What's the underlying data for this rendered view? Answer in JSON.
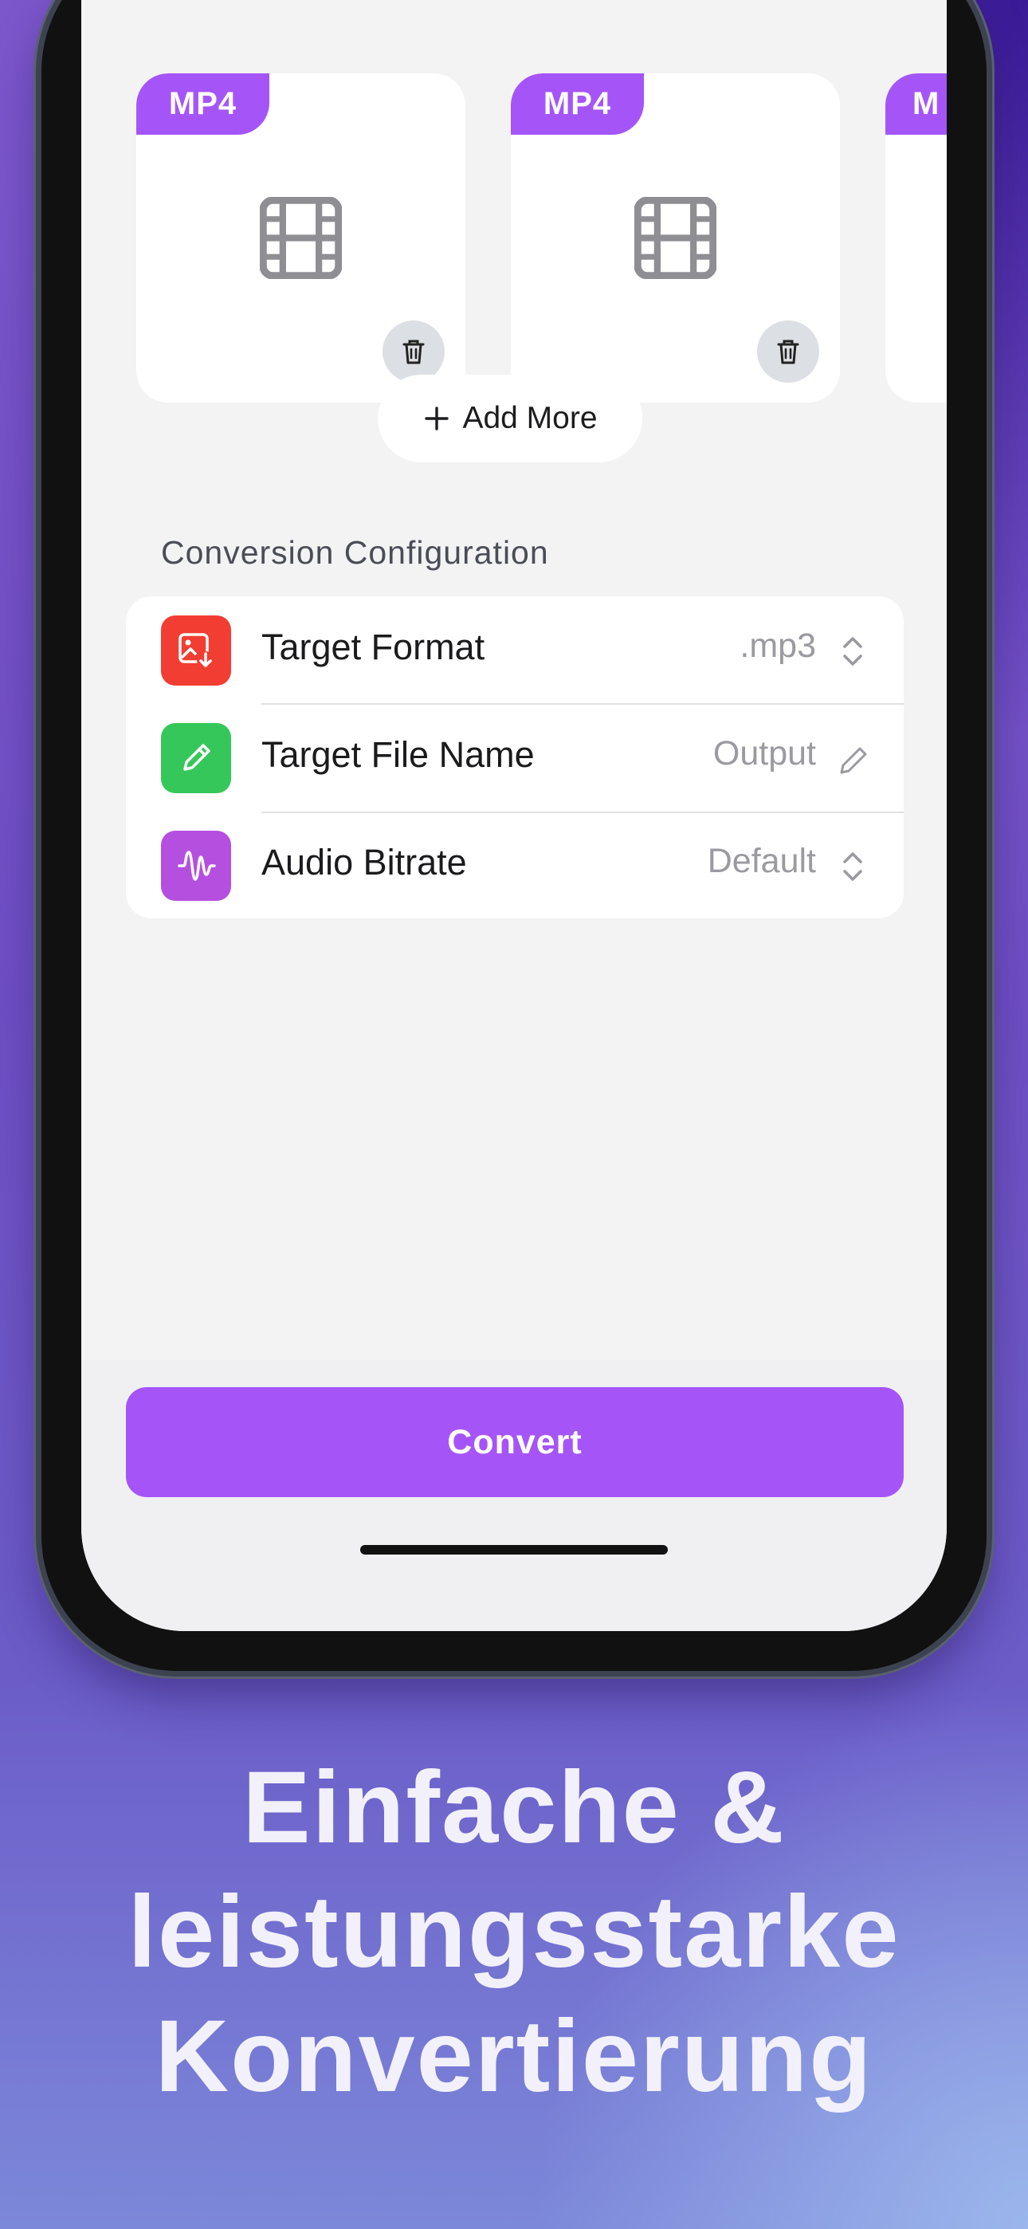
{
  "files": [
    {
      "badge": "MP4"
    },
    {
      "badge": "MP4"
    },
    {
      "badge": "M"
    }
  ],
  "add_more_label": "Add More",
  "config": {
    "section_title": "Conversion Configuration",
    "rows": [
      {
        "label": "Target Format",
        "value": ".mp3",
        "icon": "image-download-icon",
        "icon_color": "#f23d33",
        "accessory": "chevron-up-down-icon"
      },
      {
        "label": "Target File Name",
        "value": "Output",
        "icon": "pencil-icon",
        "icon_color": "#35c75a",
        "accessory": "pencil-icon"
      },
      {
        "label": "Audio Bitrate",
        "value": "Default",
        "icon": "waveform-icon",
        "icon_color": "#b54fe0",
        "accessory": "chevron-up-down-icon"
      }
    ]
  },
  "convert_label": "Convert",
  "headline": {
    "line1": "Einfache &",
    "line2": "leistungsstarke",
    "line3": "Konvertierung"
  },
  "colors": {
    "accent": "#a555f7",
    "background_purple": "#7558c9"
  }
}
